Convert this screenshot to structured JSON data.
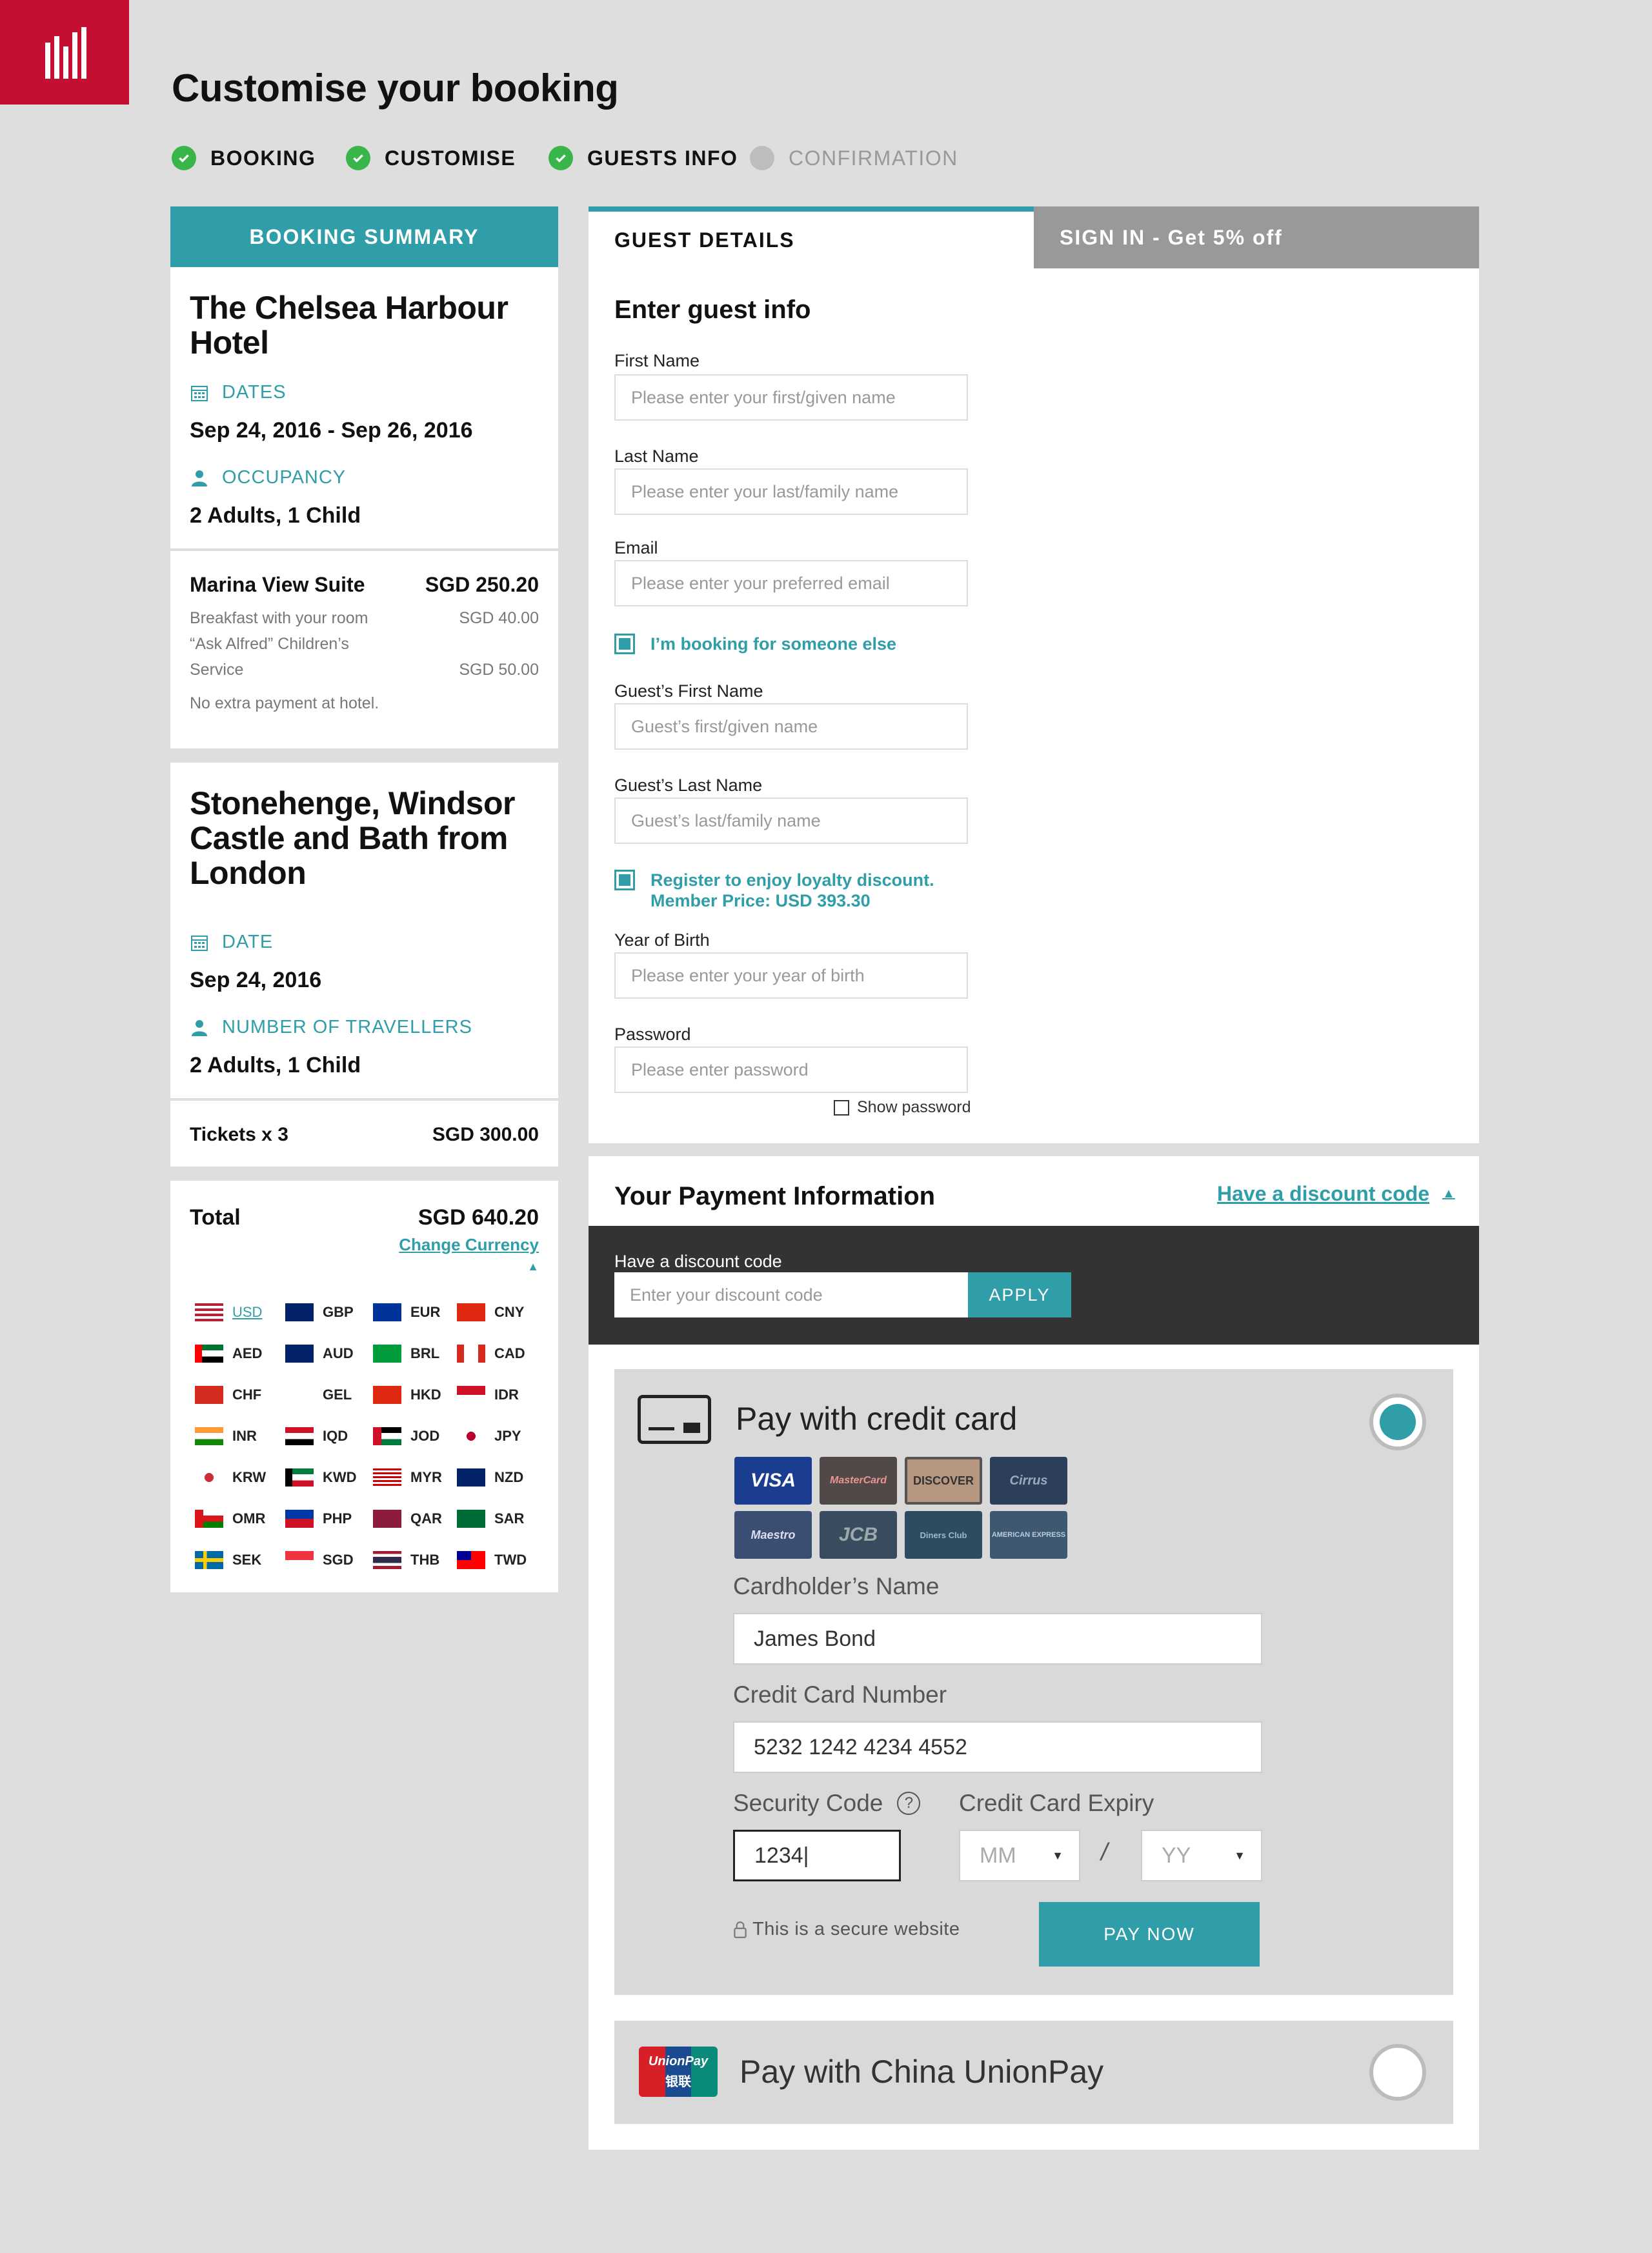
{
  "page": {
    "title": "Customise your booking"
  },
  "steps": [
    {
      "label": "BOOKING",
      "state": "done"
    },
    {
      "label": "CUSTOMISE",
      "state": "done"
    },
    {
      "label": "GUESTS INFO",
      "state": "done"
    },
    {
      "label": "CONFIRMATION",
      "state": "pending"
    }
  ],
  "summary": {
    "heading": "BOOKING SUMMARY",
    "hotel": {
      "name_line1": "The Chelsea Harbour",
      "name_line2": "Hotel",
      "dates_label": "DATES",
      "dates_value": "Sep 24, 2016 - Sep 26, 2016",
      "occupancy_label": "OCCUPANCY",
      "occupancy_value": "2 Adults, 1 Child",
      "room_name": "Marina View Suite",
      "room_price": "SGD 250.20",
      "extra1_name": "Breakfast with your room",
      "extra1_price": "SGD 40.00",
      "extra2_line1": "“Ask Alfred” Children’s",
      "extra2_line2": "Service",
      "extra2_price": "SGD 50.00",
      "note": "No extra payment at hotel."
    },
    "tour": {
      "name_line1": "Stonehenge, Windsor",
      "name_line2": "Castle and Bath from",
      "name_line3": "London",
      "date_label": "DATE",
      "date_value": "Sep 24, 2016",
      "travellers_label": "NUMBER OF TRAVELLERS",
      "travellers_value": "2 Adults, 1 Child",
      "tickets_label": "Tickets x 3",
      "tickets_price": "SGD 300.00"
    },
    "total_label": "Total",
    "total_value": "SGD 640.20",
    "change_currency": "Change Currency",
    "currencies": [
      "USD",
      "GBP",
      "EUR",
      "CNY",
      "AED",
      "AUD",
      "BRL",
      "CAD",
      "CHF",
      "GEL",
      "HKD",
      "IDR",
      "INR",
      "IQD",
      "JOD",
      "JPY",
      "KRW",
      "KWD",
      "MYR",
      "NZD",
      "OMR",
      "PHP",
      "QAR",
      "SAR",
      "SEK",
      "SGD",
      "THB",
      "TWD"
    ],
    "selected_currency": "USD"
  },
  "guest": {
    "tab_guest": "GUEST DETAILS",
    "tab_signin": "SIGN IN - Get 5% off",
    "heading": "Enter guest info",
    "first_name_label": "First Name",
    "first_name_placeholder": "Please enter your first/given name",
    "last_name_label": "Last Name",
    "last_name_placeholder": "Please enter your last/family name",
    "email_label": "Email",
    "email_placeholder": "Please enter your preferred email",
    "someone_else": "I’m booking for someone else",
    "guest_first_label": "Guest’s First Name",
    "guest_first_placeholder": "Guest’s first/given name",
    "guest_last_label": "Guest’s Last Name",
    "guest_last_placeholder": "Guest’s last/family name",
    "loyalty_line1": "Register to enjoy loyalty discount.",
    "loyalty_line2": "Member Price: USD 393.30",
    "yob_label": "Year of Birth",
    "yob_placeholder": "Please enter your year of birth",
    "password_label": "Password",
    "password_placeholder": "Please enter password",
    "show_password": "Show password"
  },
  "payment": {
    "heading": "Your Payment Information",
    "discount_link": "Have a discount code",
    "discount_label": "Have a discount code",
    "discount_placeholder": "Enter your discount code",
    "apply": "APPLY",
    "credit_title": "Pay with credit card",
    "card_brands": [
      "VISA",
      "MasterCard",
      "DISCOVER",
      "Cirrus",
      "Maestro",
      "JCB",
      "Diners Club",
      "AMERICAN EXPRESS"
    ],
    "cardholder_label": "Cardholder’s Name",
    "cardholder_value": "James Bond",
    "number_label": "Credit Card Number",
    "number_value": "5232 1242 4234 4552",
    "security_label": "Security Code",
    "security_value": "1234|",
    "expiry_label": "Credit Card Expiry",
    "month_placeholder": "MM",
    "year_placeholder": "YY",
    "slash": "/",
    "secure_note": "This is a secure website",
    "pay_now": "PAY NOW",
    "unionpay_title": "Pay with China UnionPay",
    "unionpay_logo_line1": "UnionPay",
    "unionpay_logo_line2": "银联"
  },
  "colors": {
    "accent": "#2f9ea8",
    "brand": "#c40f33",
    "success": "#3ab54a"
  }
}
